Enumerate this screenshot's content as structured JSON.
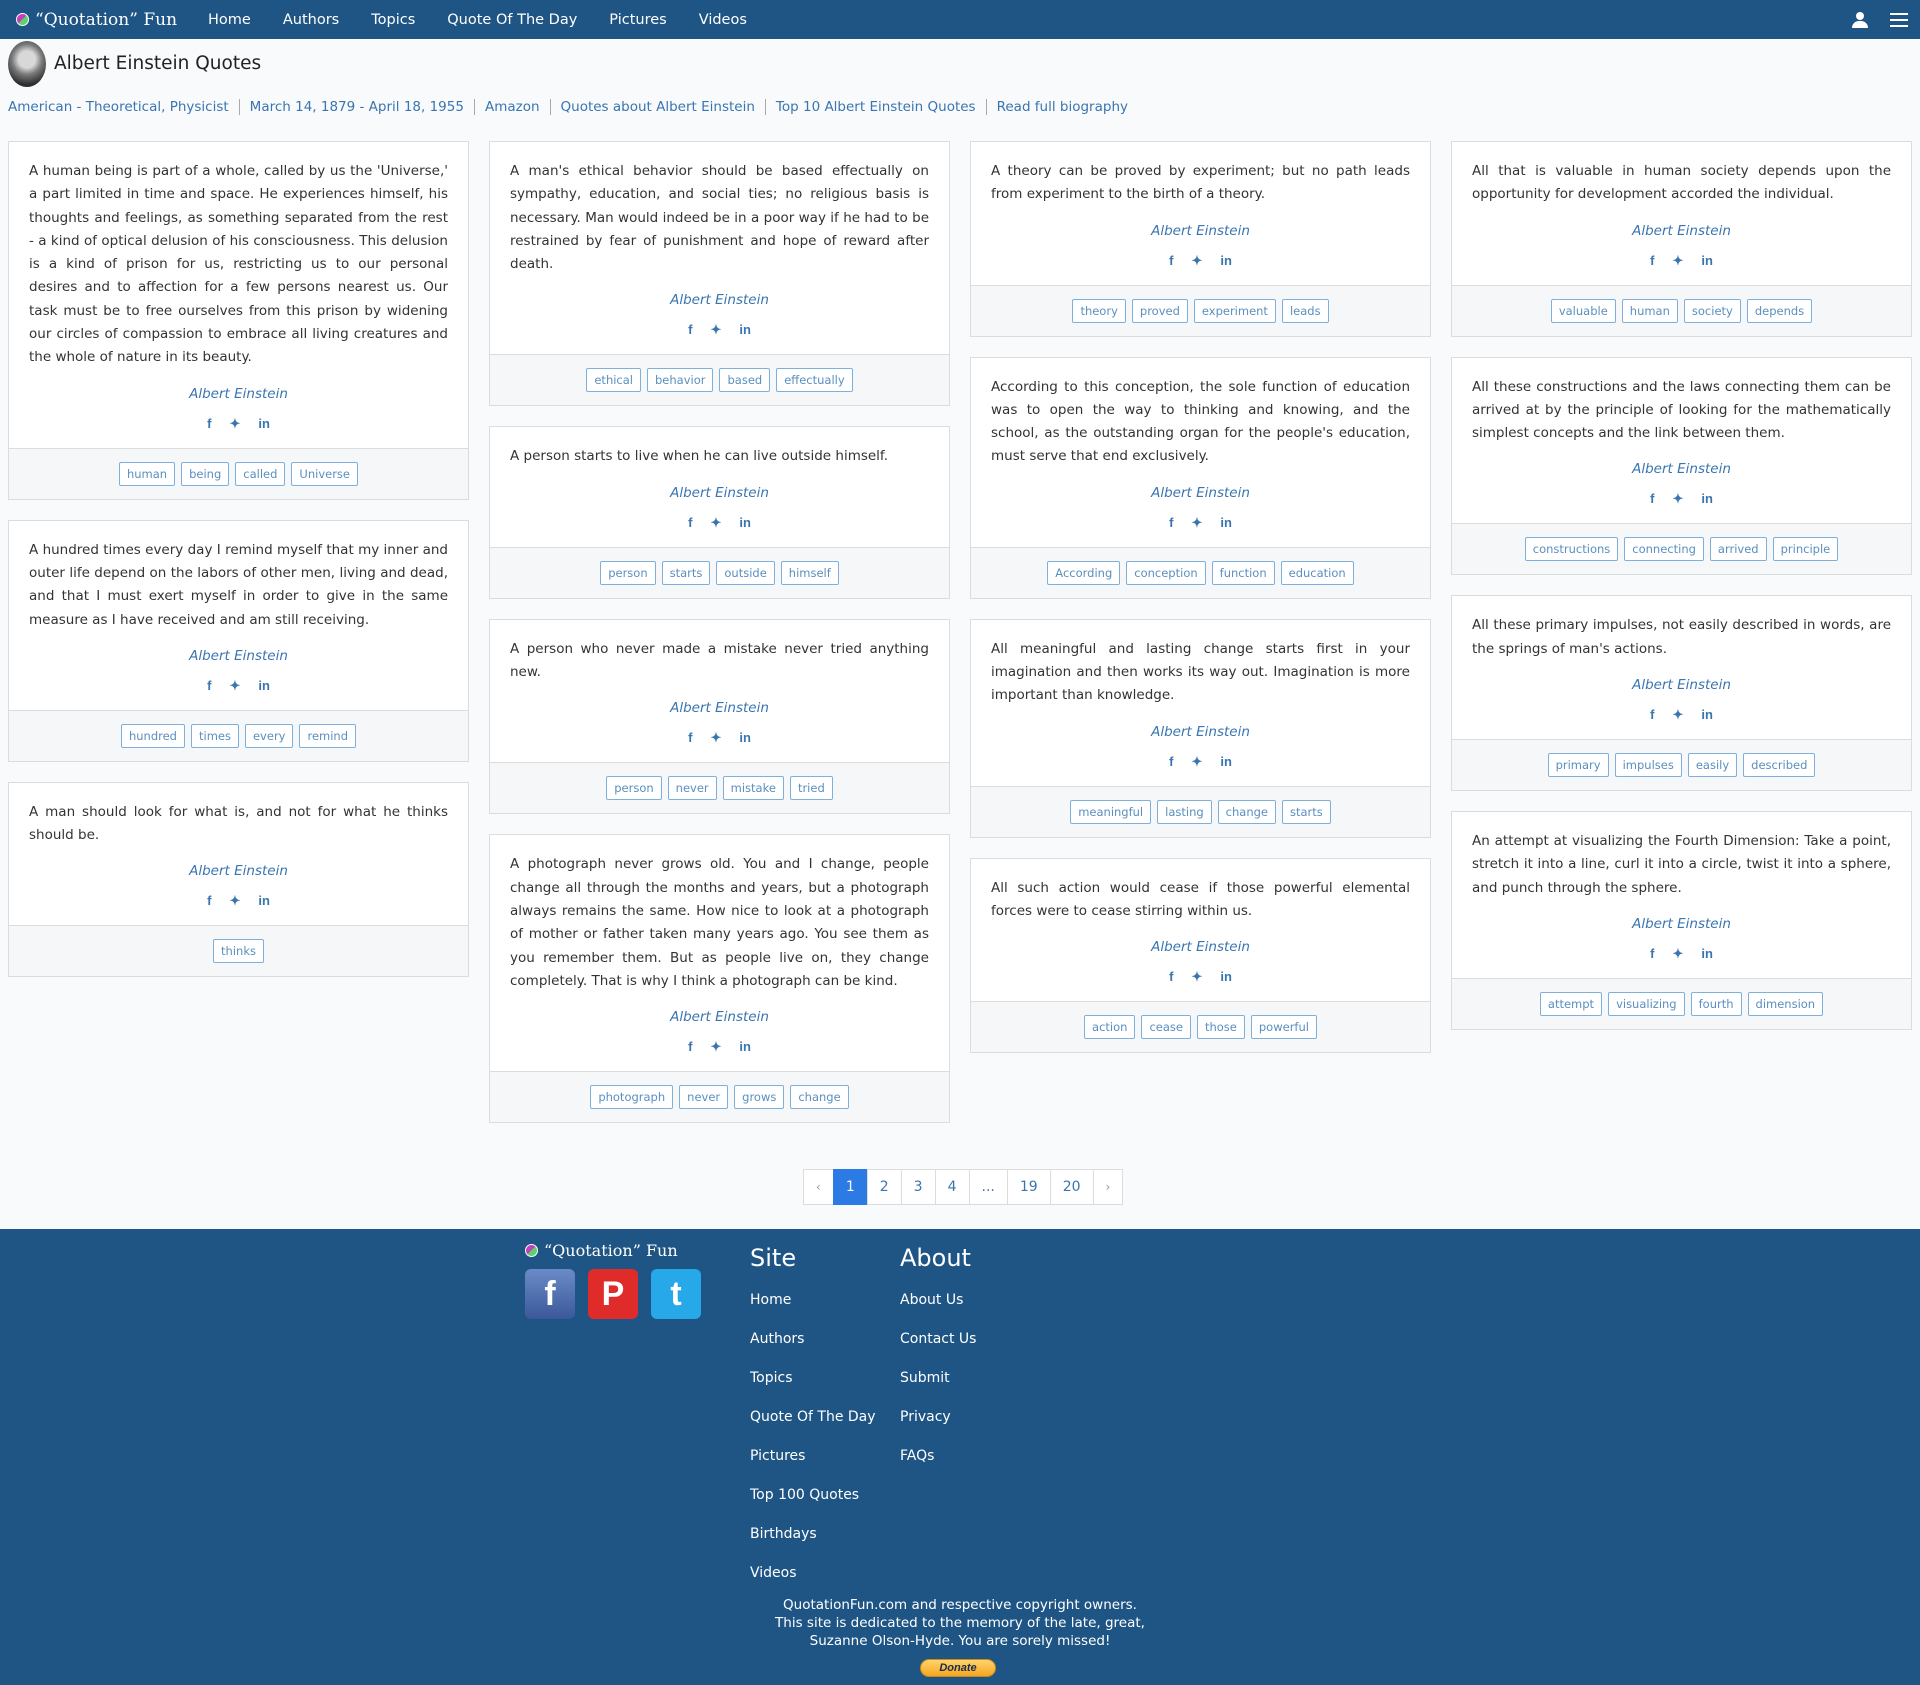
{
  "nav": {
    "brand": "“Quotation” Fun",
    "links": [
      "Home",
      "Authors",
      "Topics",
      "Quote Of The Day",
      "Pictures",
      "Videos"
    ]
  },
  "author": {
    "title": "Albert Einstein Quotes",
    "meta": [
      "American - Theoretical, Physicist",
      "March 14, 1879 - April 18, 1955",
      "Amazon",
      "Quotes about Albert Einstein",
      "Top 10 Albert Einstein Quotes",
      "Read full biography"
    ]
  },
  "social_icons": [
    "facebook-icon",
    "twitter-icon",
    "linkedin-icon"
  ],
  "columns": [
    [
      {
        "text": "A human being is part of a whole, called by us the 'Universe,' a part limited in time and space. He experiences himself, his thoughts and feelings, as something separated from the rest - a kind of optical delusion of his consciousness. This delusion is a kind of prison for us, restricting us to our personal desires and to affection for a few persons nearest us. Our task must be to free ourselves from this prison by widening our circles of compassion to embrace all living creatures and the whole of nature in its beauty.",
        "author": "Albert Einstein",
        "tags": [
          "human",
          "being",
          "called",
          "Universe"
        ]
      },
      {
        "text": "A hundred times every day I remind myself that my inner and outer life depend on the labors of other men, living and dead, and that I must exert myself in order to give in the same measure as I have received and am still receiving.",
        "author": "Albert Einstein",
        "tags": [
          "hundred",
          "times",
          "every",
          "remind"
        ]
      },
      {
        "text": "A man should look for what is, and not for what he thinks should be.",
        "author": "Albert Einstein",
        "tags": [
          "thinks"
        ]
      }
    ],
    [
      {
        "text": "A man's ethical behavior should be based effectually on sympathy, education, and social ties; no religious basis is necessary. Man would indeed be in a poor way if he had to be restrained by fear of punishment and hope of reward after death.",
        "author": "Albert Einstein",
        "tags": [
          "ethical",
          "behavior",
          "based",
          "effectually"
        ]
      },
      {
        "text": "A person starts to live when he can live outside himself.",
        "author": "Albert Einstein",
        "tags": [
          "person",
          "starts",
          "outside",
          "himself"
        ]
      },
      {
        "text": "A person who never made a mistake never tried anything new.",
        "author": "Albert Einstein",
        "tags": [
          "person",
          "never",
          "mistake",
          "tried"
        ]
      },
      {
        "text": "A photograph never grows old. You and I change, people change all through the months and years, but a photograph always remains the same. How nice to look at a photograph of mother or father taken many years ago. You see them as you remember them. But as people live on, they change completely. That is why I think a photograph can be kind.",
        "author": "Albert Einstein",
        "tags": [
          "photograph",
          "never",
          "grows",
          "change"
        ]
      }
    ],
    [
      {
        "text": "A theory can be proved by experiment; but no path leads from experiment to the birth of a theory.",
        "author": "Albert Einstein",
        "tags": [
          "theory",
          "proved",
          "experiment",
          "leads"
        ]
      },
      {
        "text": "According to this conception, the sole function of education was to open the way to thinking and knowing, and the school, as the outstanding organ for the people's education, must serve that end exclusively.",
        "author": "Albert Einstein",
        "tags": [
          "According",
          "conception",
          "function",
          "education"
        ]
      },
      {
        "text": "All meaningful and lasting change starts first in your imagination and then works its way out. Imagination is more important than knowledge.",
        "author": "Albert Einstein",
        "tags": [
          "meaningful",
          "lasting",
          "change",
          "starts"
        ]
      },
      {
        "text": "All such action would cease if those powerful elemental forces were to cease stirring within us.",
        "author": "Albert Einstein",
        "tags": [
          "action",
          "cease",
          "those",
          "powerful"
        ]
      }
    ],
    [
      {
        "text": "All that is valuable in human society depends upon the opportunity for development accorded the individual.",
        "author": "Albert Einstein",
        "tags": [
          "valuable",
          "human",
          "society",
          "depends"
        ]
      },
      {
        "text": "All these constructions and the laws connecting them can be arrived at by the principle of looking for the mathematically simplest concepts and the link between them.",
        "author": "Albert Einstein",
        "tags": [
          "constructions",
          "connecting",
          "arrived",
          "principle"
        ]
      },
      {
        "text": "All these primary impulses, not easily described in words, are the springs of man's actions.",
        "author": "Albert Einstein",
        "tags": [
          "primary",
          "impulses",
          "easily",
          "described"
        ]
      },
      {
        "text": "An attempt at visualizing the Fourth Dimension: Take a point, stretch it into a line, curl it into a circle, twist it into a sphere, and punch through the sphere.",
        "author": "Albert Einstein",
        "tags": [
          "attempt",
          "visualizing",
          "fourth",
          "dimension"
        ]
      }
    ]
  ],
  "pagination": [
    "‹",
    "1",
    "2",
    "3",
    "4",
    "...",
    "19",
    "20",
    "›"
  ],
  "pagination_current": "1",
  "footer": {
    "brand": "“Quotation” Fun",
    "site_heading": "Site",
    "site_links": [
      "Home",
      "Authors",
      "Topics",
      "Quote Of The Day",
      "Pictures",
      "Top 100 Quotes",
      "Birthdays",
      "Videos"
    ],
    "about_heading": "About",
    "about_links": [
      "About Us",
      "Contact Us",
      "Submit",
      "Privacy",
      "FAQs"
    ],
    "copyright": [
      "QuotationFun.com and respective copyright owners.",
      "This site is dedicated to the memory of the late, great,",
      "Suzanne Olson-Hyde. You are sorely missed!"
    ],
    "donate": "Donate"
  }
}
